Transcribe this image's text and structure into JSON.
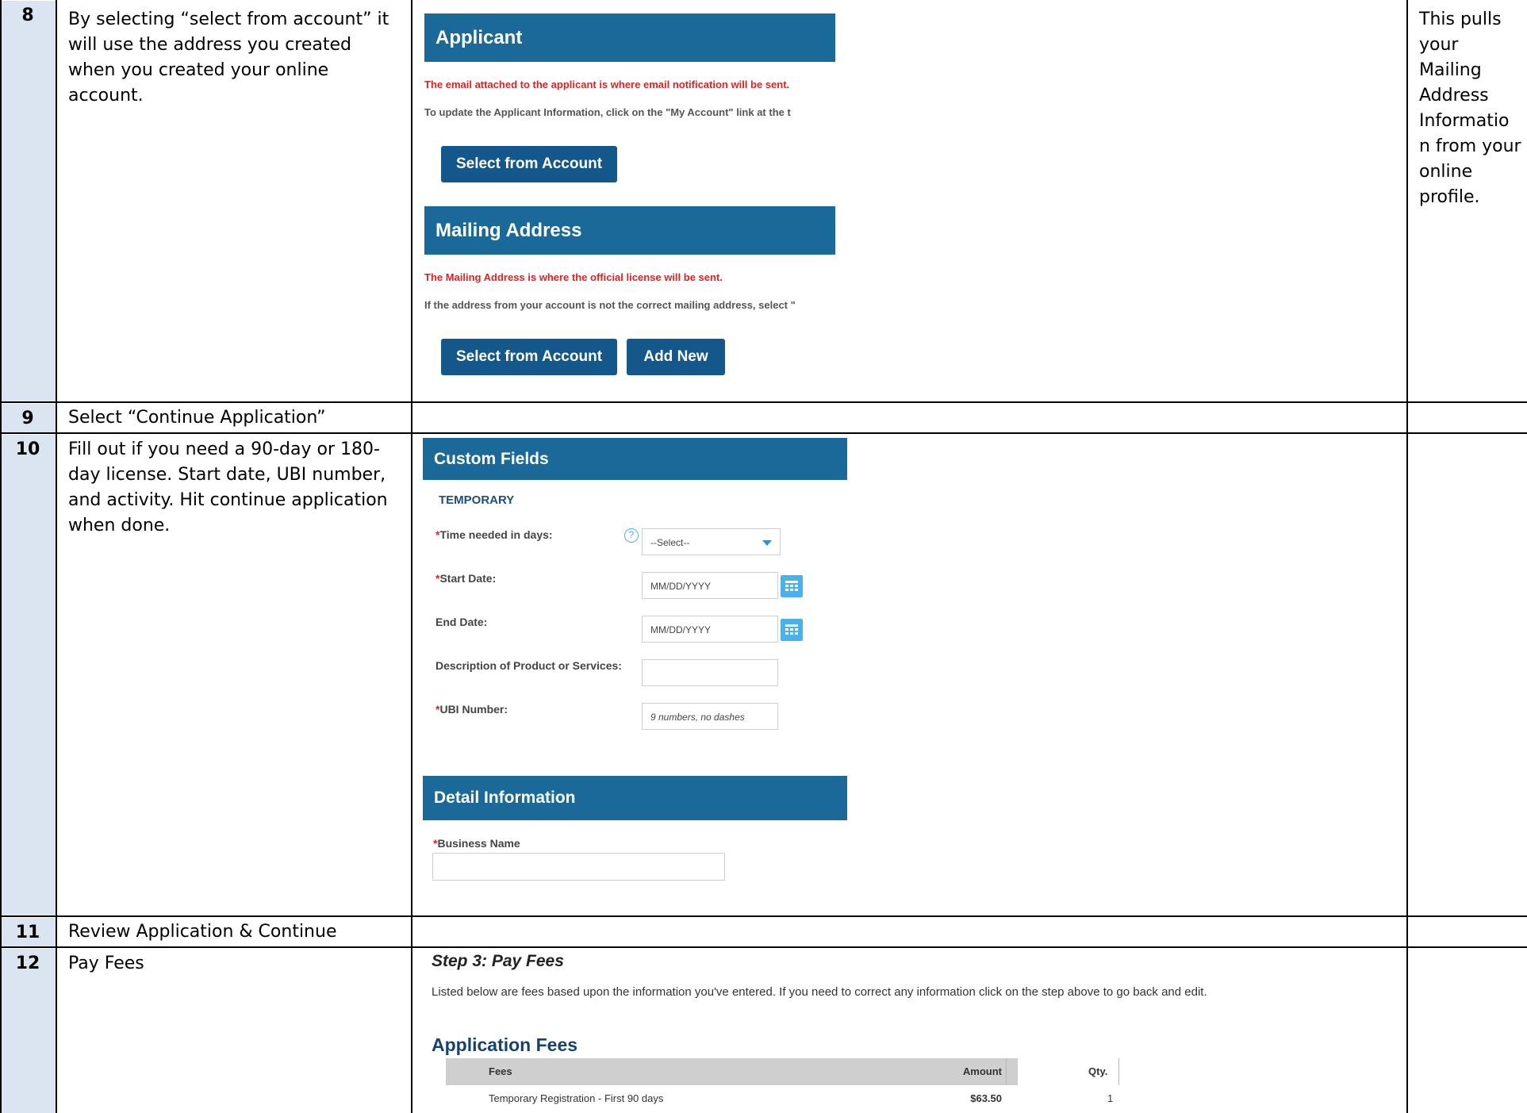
{
  "steps": [
    {
      "number": "8",
      "instruction": "By selecting “select from account” it will use the address you created when you created your online account.",
      "note": "This pulls your Mailing Address Informatio n from your online profile."
    },
    {
      "number": "9",
      "instruction": "Select “Continue Application”",
      "note": ""
    },
    {
      "number": "10",
      "instruction": "Fill out if you need a 90-day or 180-day license. Start date, UBI number, and activity. Hit continue application when done.",
      "note": ""
    },
    {
      "number": "11",
      "instruction": "Review Application & Continue",
      "note": ""
    },
    {
      "number": "12",
      "instruction": "Pay Fees",
      "note": ""
    }
  ],
  "shot8": {
    "applicant_title": "Applicant",
    "applicant_red": "The email attached to the applicant is where email notification will be sent.",
    "applicant_info": "To update the Applicant Information, click on the \"My Account\" link at the t",
    "select_from_account": "Select from Account",
    "mailing_title": "Mailing Address",
    "mailing_red": "The Mailing Address is where the official license will be sent.",
    "mailing_info": "If the address from your account is not the correct mailing address, select \"",
    "select_from_account_2": "Select from Account",
    "add_new": "Add New"
  },
  "shot10": {
    "custom_fields_title": "Custom Fields",
    "section": "TEMPORARY",
    "req_mark": "*",
    "time_label": "Time needed in days:",
    "time_select": "--Select--",
    "start_label": "Start Date:",
    "start_placeholder": "MM/DD/YYYY",
    "end_label": "End Date:",
    "end_placeholder": "MM/DD/YYYY",
    "desc_label": "Description of Product or Services:",
    "ubi_label": "UBI Number:",
    "ubi_placeholder": "9 numbers, no dashes",
    "detail_title": "Detail Information",
    "business_label": "Business Name"
  },
  "shot12": {
    "step_title": "Step 3: Pay Fees",
    "description": "Listed below are fees based upon the information you've entered.  If you need to correct any information click on the step above to go back and edit.",
    "fees_heading": "Application Fees",
    "columns": [
      "Fees",
      "Qty.",
      "Amount"
    ],
    "rows": [
      {
        "fee": "Temporary Registration - First 90 days",
        "qty": "1",
        "amount": "$63.50"
      }
    ]
  },
  "colors": {
    "banner": "#1a6999",
    "button": "#14578a",
    "number_cell": "#dbe5f1",
    "required": "#e32020",
    "calendar": "#4ab1ea"
  }
}
